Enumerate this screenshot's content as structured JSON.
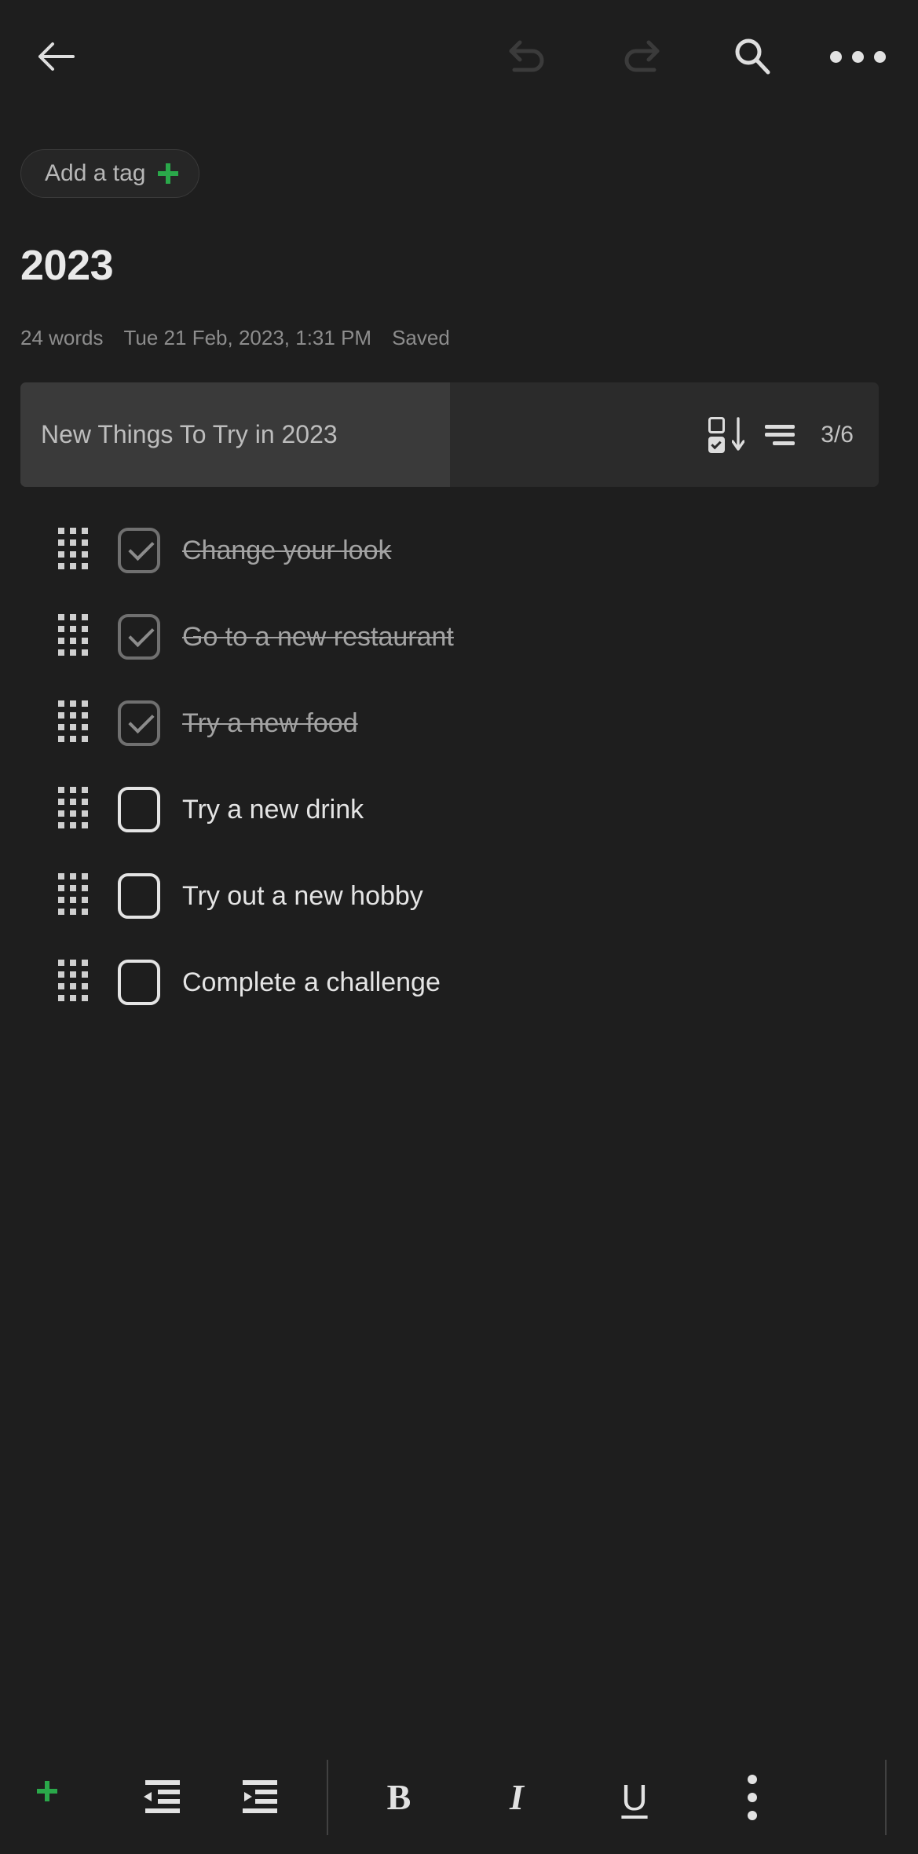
{
  "theme": {
    "background": "#1e1e1e",
    "accent_green": "#2aa84a",
    "text_primary": "#e4e4e4",
    "text_muted": "#8d8d8d",
    "checklist_track": "#2b2b2b",
    "checklist_fill": "#3a3a3a"
  },
  "topbar": {
    "back_label": "Back",
    "undo_label": "Undo",
    "redo_label": "Redo",
    "search_label": "Search",
    "more_label": "More options",
    "undo_enabled": "false",
    "redo_enabled": "false"
  },
  "tag": {
    "label": "Add a tag",
    "plus_label": "+"
  },
  "note": {
    "title": "2023",
    "word_count": "24 words",
    "timestamp": "Tue 21 Feb, 2023, 1:31 PM",
    "save_status": "Saved"
  },
  "checklist": {
    "title": "New Things To Try in 2023",
    "counter": "3/6",
    "checked_count": 3,
    "total_count": 6,
    "progress_percent": 50,
    "sort_label": "Sort checked items",
    "align_label": "Text alignment",
    "items": [
      {
        "label": "Change your look",
        "checked": true
      },
      {
        "label": "Go to a new restaurant",
        "checked": true
      },
      {
        "label": "Try a new food",
        "checked": true
      },
      {
        "label": "Try a new drink",
        "checked": false
      },
      {
        "label": "Try out a new hobby",
        "checked": false
      },
      {
        "label": "Complete a challenge",
        "checked": false
      }
    ]
  },
  "toolbar": {
    "add_label": "+",
    "outdent_label": "Decrease indent",
    "indent_label": "Increase indent",
    "bold_label": "B",
    "italic_label": "I",
    "underline_label": "U",
    "more_label": "More formatting"
  }
}
